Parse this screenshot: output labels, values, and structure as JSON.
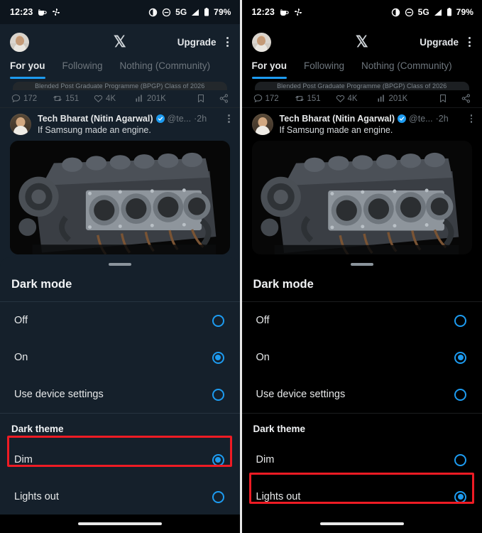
{
  "status_bar": {
    "time": "12:23",
    "left_icons": [
      "coffee-cup-icon",
      "fan-pinwheel-icon"
    ],
    "right_icons": [
      "brightness-contrast-icon",
      "do-not-disturb-icon",
      "signal-icon",
      "battery-icon"
    ],
    "network": "5G",
    "battery": "79%"
  },
  "app_bar": {
    "logo": "x-logo",
    "upgrade_label": "Upgrade",
    "avatar": "profile-avatar",
    "more": "kebab-menu-icon"
  },
  "tabs": [
    {
      "label": "For you",
      "active": true
    },
    {
      "label": "Following",
      "active": false
    },
    {
      "label": "Nothing (Community)",
      "active": false
    }
  ],
  "feed": {
    "promo_card_text": "Blended Post Graduate Programme (BPGP) Class of 2026",
    "previous_post_actions": {
      "replies": "172",
      "reposts": "151",
      "likes": "4K",
      "views": "201K",
      "bookmark": "bookmark-icon",
      "share": "share-icon"
    },
    "post": {
      "author": "Tech Bharat (Nitin Agarwal)",
      "verified": true,
      "handle": "@te...",
      "time": "2h",
      "text": "If Samsung made an engine.",
      "media_alt": "cutaway-v-engine-photo"
    }
  },
  "sheet": {
    "title": "Dark mode",
    "mode_options": [
      {
        "label": "Off",
        "selected": false
      },
      {
        "label": "On",
        "selected": true
      },
      {
        "label": "Use device settings",
        "selected": false
      }
    ],
    "theme_section_title": "Dark theme",
    "theme_options_left": [
      {
        "label": "Dim",
        "selected": true,
        "highlighted": true
      },
      {
        "label": "Lights out",
        "selected": false,
        "highlighted": false
      }
    ],
    "theme_options_right": [
      {
        "label": "Dim",
        "selected": false,
        "highlighted": false
      },
      {
        "label": "Lights out",
        "selected": true,
        "highlighted": true
      }
    ]
  },
  "colors": {
    "accent": "#1d9bf0",
    "highlight": "#ee1b24",
    "dim_background": "#15202b",
    "lights_out_background": "#000000"
  },
  "nav": {
    "gesture_bar": "home-gesture-bar"
  }
}
